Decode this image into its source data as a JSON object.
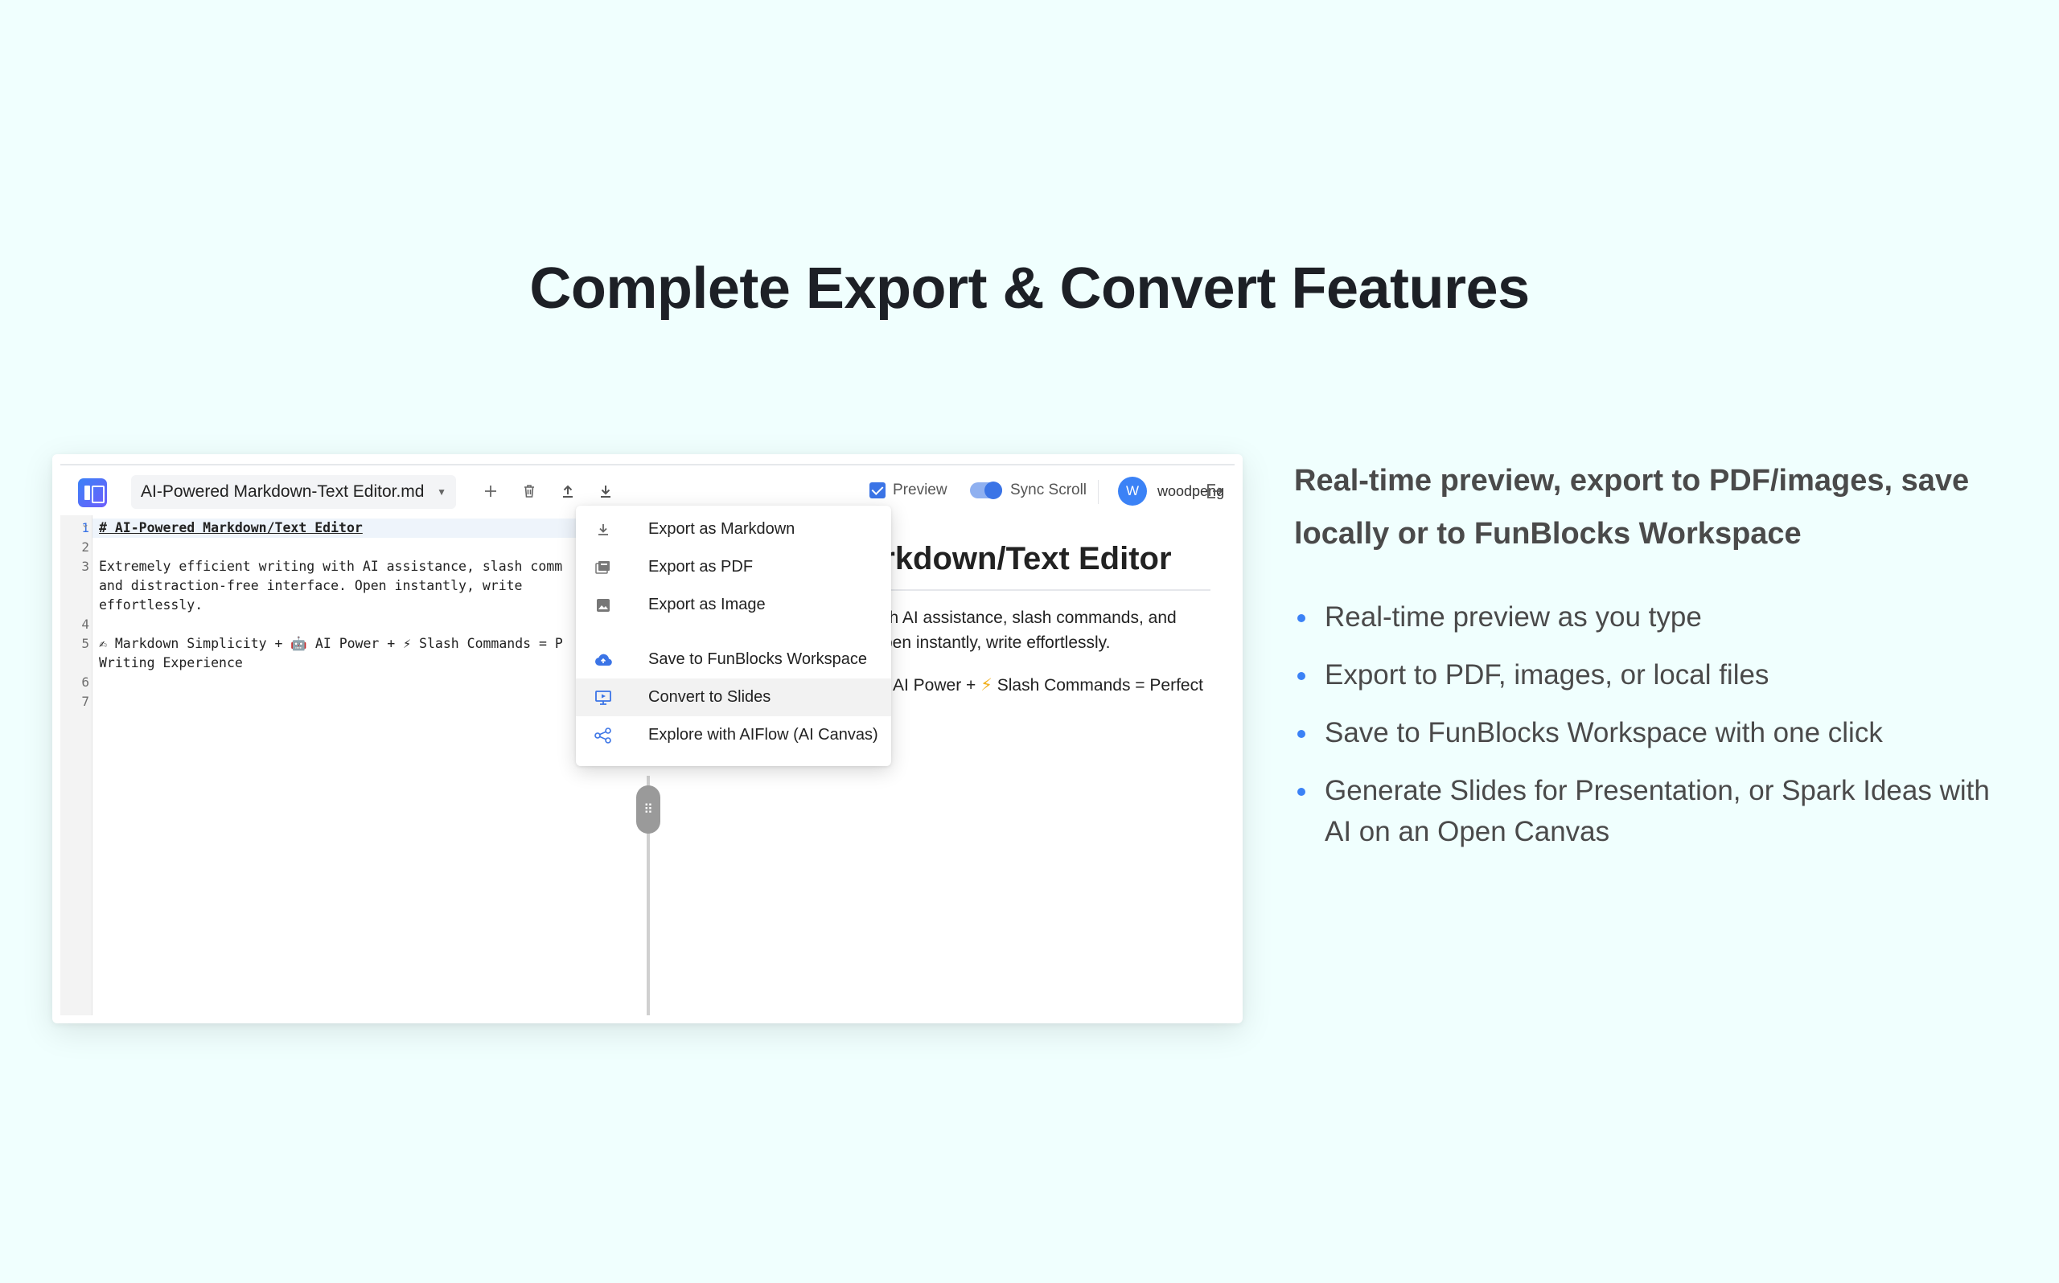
{
  "hero": {
    "title": "Complete Export & Convert Features"
  },
  "editor": {
    "file_name": "AI-Powered Markdown-Text Editor.md",
    "toolbar": {
      "new_icon": "plus-icon",
      "delete_icon": "trash-icon",
      "upload_icon": "upload-icon",
      "download_icon": "download-icon",
      "preview_label": "Preview",
      "sync_scroll_label": "Sync Scroll",
      "avatar_initial": "W",
      "username": "woodpeng",
      "logout_icon": "logout-icon"
    },
    "lines": {
      "n1": "1",
      "n2": "2",
      "n3": "3",
      "n4": "4",
      "n5": "5",
      "n6": "6",
      "n7": "7",
      "l1": "# AI-Powered Markdown/Text Editor",
      "l3a": "Extremely efficient writing with AI assistance, slash comm",
      "l3b": "and distraction-free interface. Open instantly, write",
      "l3c": "effortlessly.",
      "l5a": "✍ Markdown Simplicity + 🤖 AI Power + ⚡ Slash Commands = P",
      "l5b": "Writing Experience"
    },
    "preview": {
      "h1": "arkdown/Text Editor",
      "p1a": "ith AI assistance, slash commands, and",
      "p1b": "pen instantly, write effortlessly.",
      "p2a": "AI Power + ",
      "p2bolt": "⚡",
      "p2b": " Slash Commands = Perfect"
    },
    "export_menu": {
      "items": [
        {
          "label": "Export as Markdown",
          "icon": "download-icon"
        },
        {
          "label": "Export as PDF",
          "icon": "pdf-icon"
        },
        {
          "label": "Export as Image",
          "icon": "image-icon"
        },
        {
          "label": "Save to FunBlocks Workspace",
          "icon": "cloud-upload-icon"
        },
        {
          "label": "Convert to Slides",
          "icon": "slides-icon"
        },
        {
          "label": "Explore with AIFlow (AI Canvas)",
          "icon": "share-nodes-icon"
        }
      ]
    }
  },
  "right": {
    "subtitle": "Real-time preview, export to PDF/images, save locally or to FunBlocks Workspace",
    "features": [
      "Real-time preview as you type",
      "Export to PDF, images, or local files",
      "Save to FunBlocks Workspace with one click",
      "Generate Slides for Presentation, or Spark Ideas with AI on an Open Canvas"
    ]
  },
  "colors": {
    "accent": "#3b82f6",
    "background": "#f0fffe",
    "text": "#4a4a4a"
  }
}
